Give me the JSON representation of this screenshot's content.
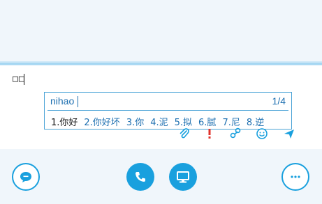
{
  "compose": {
    "text": "□□"
  },
  "ime": {
    "pinyin": "nihao",
    "page": "1/4",
    "candidates": [
      "1.你好",
      "2.你好坏",
      "3.你",
      "4.泥",
      "5.拟",
      "6.腻",
      "7.尼",
      "8.逆"
    ]
  },
  "toolbar": {
    "icons": [
      "paperclip-icon",
      "alert-icon",
      "link-icon",
      "smiley-icon",
      "send-icon"
    ]
  },
  "bottom_bar": {
    "buttons": [
      "chat-button",
      "call-button",
      "screen-share-button",
      "more-button"
    ]
  },
  "colors": {
    "accent": "#19a0de",
    "ime_text": "#1d6fb0",
    "alert": "#e0322b",
    "panel_bg": "#f0f6fb"
  }
}
